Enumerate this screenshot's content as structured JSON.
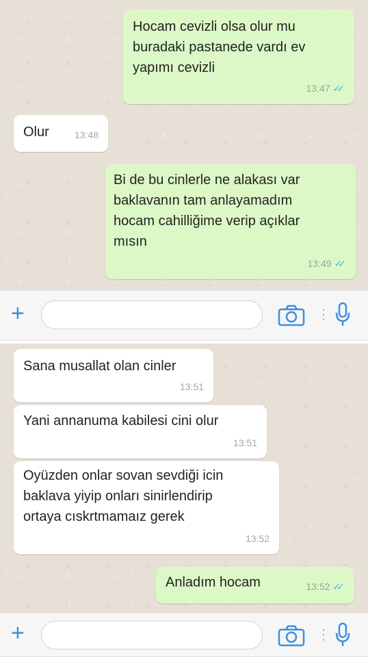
{
  "messages_top": [
    {
      "dir": "out",
      "text": "Hocam cevizli olsa olur mu\nburadaki pastanede vardı ev\nyapımı cevizli",
      "time": "13:47",
      "ticks": true
    },
    {
      "dir": "in",
      "text": "Olur",
      "time": "13:48",
      "ticks": false
    },
    {
      "dir": "out",
      "text": "Bi de bu cinlerle ne alakası var\nbaklavanın tam anlayamadım\nhocam cahilliğime verip açıklar\nmısın",
      "time": "13:49",
      "ticks": true
    }
  ],
  "messages_bottom": [
    {
      "dir": "in",
      "text": "Sana musallat olan cinler",
      "time": "13:51",
      "ticks": false
    },
    {
      "dir": "in",
      "text": "Yani annanuma kabilesi cini olur",
      "time": "13:51",
      "ticks": false
    },
    {
      "dir": "in",
      "text": "Oyüzden onlar sovan sevdiği icin\nbaklava yiyip onları sinirlendirip\nortaya cıskrtmamaız gerek",
      "time": "13:52",
      "ticks": false
    },
    {
      "dir": "out",
      "text": "Anladım hocam",
      "time": "13:52",
      "ticks": true
    }
  ],
  "input_bar": {
    "plus_icon": "plus-icon",
    "camera_icon": "camera-icon",
    "mic_icon": "microphone-icon",
    "accent_color": "#3b8fdc"
  },
  "colors": {
    "outgoing_bubble": "#dcf8c6",
    "incoming_bubble": "#ffffff",
    "read_ticks": "#4fb3e8",
    "wallpaper": "#e7e0d6"
  }
}
